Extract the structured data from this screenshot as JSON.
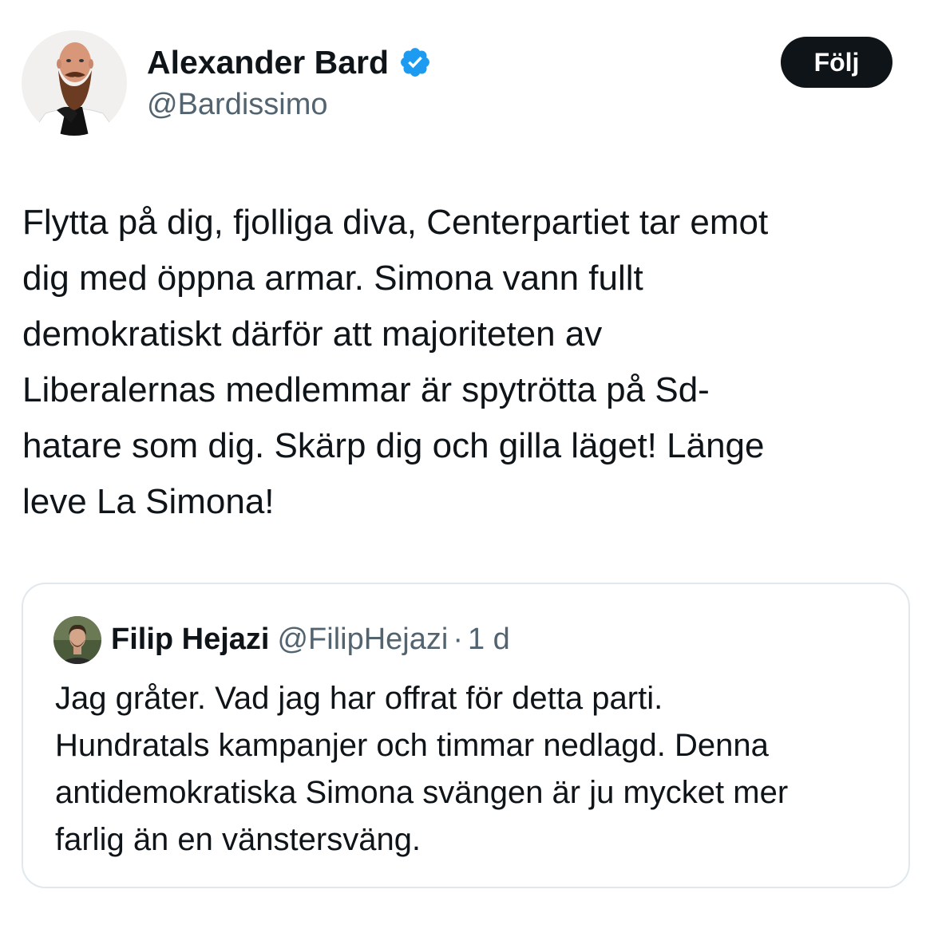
{
  "tweet": {
    "author": {
      "name": "Alexander Bard",
      "handle": "@Bardissimo",
      "verified": true,
      "avatar_icon": "avatar-bearded-man"
    },
    "follow_label": "Följ",
    "text_lines": [
      "Flytta på dig, fjolliga diva, Centerpartiet tar emot",
      "dig med öppna armar. Simona vann fullt",
      "demokratiskt därför att majoriteten av",
      "Liberalernas medlemmar är spytrötta på Sd-",
      "hatare som dig. Skärp dig och gilla läget! Länge",
      "leve La Simona!"
    ]
  },
  "quoted_tweet": {
    "author": {
      "name": "Filip Hejazi",
      "handle": "@FilipHejazi",
      "avatar_icon": "avatar-man"
    },
    "separator": "·",
    "time": "1 d",
    "text_lines": [
      "Jag gråter. Vad jag har offrat för detta parti.",
      "Hundratals kampanjer och timmar nedlagd. Denna",
      "antidemokratiska Simona svängen är ju mycket mer",
      "farlig än en vänstersväng."
    ]
  },
  "colors": {
    "text_primary": "#0f1419",
    "text_secondary": "#536471",
    "verified_blue": "#1d9bf0",
    "button_bg": "#0f1419",
    "card_border": "#e1e8ed"
  }
}
